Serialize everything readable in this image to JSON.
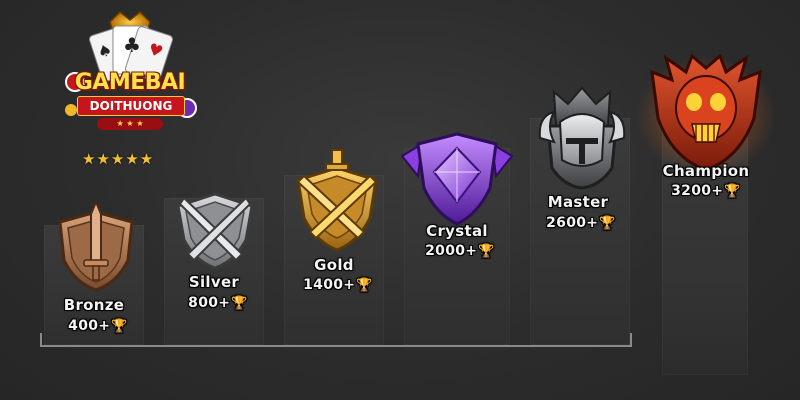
{
  "logo": {
    "line1": "GAMEBAI",
    "line2": "DOITHUONG",
    "line3": "★ ★ ★",
    "stars": "★★★★★",
    "rating": 5
  },
  "tiers": [
    {
      "name": "Bronze",
      "points": "400+",
      "color": "#b07a52",
      "icon": "bronze-shield-sword-icon"
    },
    {
      "name": "Silver",
      "points": "800+",
      "color": "#a7a9ab",
      "icon": "silver-crossed-swords-icon"
    },
    {
      "name": "Gold",
      "points": "1400+",
      "color": "#d9a43c",
      "icon": "gold-crossed-swords-icon"
    },
    {
      "name": "Crystal",
      "points": "2000+",
      "color": "#9b4de0",
      "icon": "crystal-gem-shield-icon"
    },
    {
      "name": "Master",
      "points": "2600+",
      "color": "#7d7f82",
      "icon": "master-helmet-icon"
    },
    {
      "name": "Champion",
      "points": "3200+",
      "color": "#c23a1e",
      "icon": "champion-skull-icon"
    }
  ],
  "trophy_glyph": "🏆",
  "colors": {
    "background": "#2f2f2f",
    "trophy": "#f0b72a",
    "champion_glow": "#ff6a1a"
  }
}
